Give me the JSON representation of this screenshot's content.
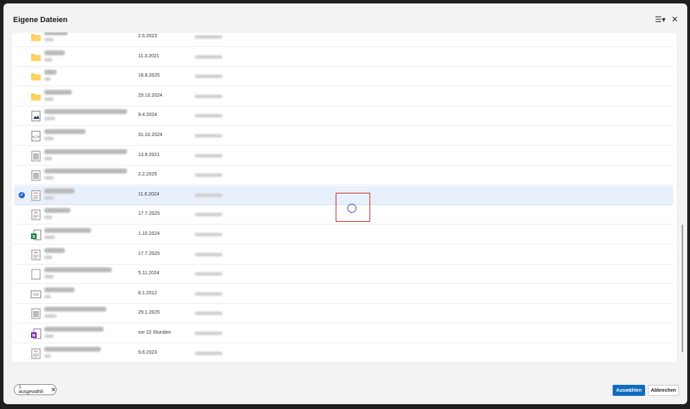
{
  "dialog": {
    "title": "Eigene Dateien"
  },
  "files": [
    {
      "name": "Blockanner",
      "sub": "22 Elt",
      "date": "2.6.2023",
      "owner": "Daniel Krapo",
      "type": "folder"
    },
    {
      "name": "Widerzeg",
      "sub": "3.5 kB",
      "date": "11.3.2021",
      "owner": "Daniel Krapo",
      "type": "folder"
    },
    {
      "name": "Arbeit",
      "sub": "1.2 kB",
      "date": "18.8.2025",
      "owner": "Daniel Krapo",
      "type": "folder"
    },
    {
      "name": "Arbeit_Backup",
      "sub": "storned",
      "date": "29.10.2024",
      "owner": "Daniel Krapo",
      "type": "folder"
    },
    {
      "name": "Screenshot-2024-04-09-at-12-03-44-mit-dieser",
      "sub": "23 kB",
      "date": "9.4.2024",
      "owner": "Daniel Krapo",
      "type": "image"
    },
    {
      "name": "source-profiles.json",
      "sub": "24.2 kB",
      "date": "31.10.2024",
      "owner": "Daniel Krapo",
      "type": "code"
    },
    {
      "name": "Einkaufsliste-Kinderbetreuungszuschuss-Dokument",
      "sub": "1.18 kB",
      "date": "13.9.2021",
      "owner": "Daniel Krapo",
      "type": "doc"
    },
    {
      "name": "cloudflare-danielkrapo@outlook.com-export",
      "sub": "10 Byte",
      "date": "2.2.2025",
      "owner": "Daniel Krapo",
      "type": "doc"
    },
    {
      "name": "SOC-Notes.pdf",
      "sub": "1.86 kB",
      "date": "11.6.2024",
      "owner": "Daniel Krapo",
      "type": "pdf",
      "selected": true
    },
    {
      "name": "Resolv_Juni.pdf",
      "sub": "1.05 kB",
      "date": "17.7.2025",
      "owner": "Daniel Krapo",
      "type": "pdf"
    },
    {
      "name": "InstalledPrograms.csv",
      "sub": "12 Zeilen",
      "date": "1.10.2024",
      "owner": "Daniel Krapo",
      "type": "excel"
    },
    {
      "name": "Kostenerzeg.pdf",
      "sub": "storned",
      "date": "17.7.2025",
      "owner": "Daniel Krapo",
      "type": "pdf"
    },
    {
      "name": "KenntnisnahmeVomDatenschutz",
      "sub": "0.93 kB",
      "date": "5.11.2024",
      "owner": "Daniel Krapo",
      "type": "blank"
    },
    {
      "name": "Bilanzkonto.csv",
      "sub": "24 kB",
      "date": "8.1.2012",
      "owner": "Daniel Krapo",
      "type": "csv"
    },
    {
      "name": "product_data_summary_realworld",
      "sub": "13 Kilobyte",
      "date": "29.1.2025",
      "owner": "Daniel Krapo",
      "type": "doc"
    },
    {
      "name": "System-Integration -- Notizbuch",
      "sub": "23.4 kB",
      "date": "vor 22 Stunden",
      "owner": "Daniel Krapo",
      "type": "onenote"
    },
    {
      "name": "Telefonat-Zugangsdaten.pdf",
      "sub": "41.8 kB",
      "date": "9.6.2023",
      "owner": "Daniel Krapo",
      "type": "pdf"
    }
  ],
  "footer": {
    "selection_label": "1 ausgewählt",
    "select_button": "Auswählen",
    "cancel_button": "Abbrechen"
  },
  "colors": {
    "accent": "#0f6cbd",
    "folder": "#f3c343",
    "selected_row": "#e8f0fb"
  },
  "icons": {
    "view_menu": "view-options-icon",
    "close": "close-icon"
  }
}
